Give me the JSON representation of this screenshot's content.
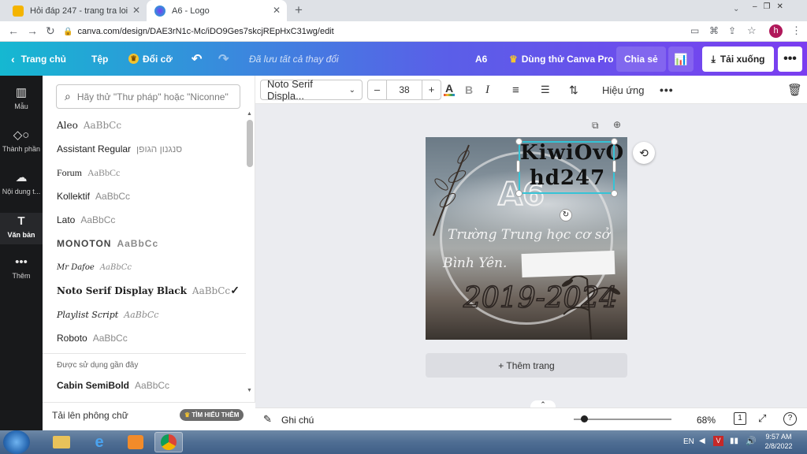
{
  "browser": {
    "tabs": [
      {
        "title": "Hỏi đáp 247 - trang tra loi",
        "active": false
      },
      {
        "title": "A6 - Logo",
        "active": true
      }
    ],
    "new_tab": "+",
    "url": "canva.com/design/DAE3rN1c-Mc/iDO9Ges7skcjREpHxC31wg/edit",
    "profile_initial": "h"
  },
  "header": {
    "home": "Trang chủ",
    "file": "Tệp",
    "resize": "Đổi cỡ",
    "saved": "Đã lưu tất cả thay đổi",
    "design_name": "A6",
    "try_pro": "Dùng thử Canva Pro",
    "share": "Chia sẻ",
    "download": "Tải xuống"
  },
  "rail": [
    {
      "label": "Mẫu",
      "icon": "template-icon"
    },
    {
      "label": "Thành phần",
      "icon": "elements-icon"
    },
    {
      "label": "Nội dung t...",
      "icon": "upload-icon"
    },
    {
      "label": "Văn bản",
      "icon": "text-icon",
      "active": true
    },
    {
      "label": "Thêm",
      "icon": "more-icon"
    }
  ],
  "font_panel": {
    "search_placeholder": "Hãy thử \"Thư pháp\" hoặc \"Niconne\"",
    "fonts": [
      {
        "name": "Aleo",
        "sample": "AaBbCc"
      },
      {
        "name": "Assistant Regular",
        "sample": "סנגנון הגופן"
      },
      {
        "name": "Forum",
        "sample": "AaBbCc"
      },
      {
        "name": "Kollektif",
        "sample": "AaBbCc"
      },
      {
        "name": "Lato",
        "sample": "AaBbCc"
      },
      {
        "name": "MONOTON",
        "sample": "AaBbCc"
      },
      {
        "name": "Mr Dafoe",
        "sample": "AaBbCc"
      },
      {
        "name": "Noto Serif Display Black",
        "sample": "AaBbCc",
        "selected": true
      },
      {
        "name": "Playlist Script",
        "sample": "AaBbCc"
      },
      {
        "name": "Roboto",
        "sample": "AaBbCc"
      }
    ],
    "recent_heading": "Được sử dụng gần đây",
    "recent": [
      {
        "name": "Cabin SemiBold",
        "sample": "AaBbCc"
      }
    ],
    "upload_font": "Tải lên phông chữ",
    "learn_more": "TÌM HIỂU THÊM"
  },
  "toolbar": {
    "font_family": "Noto Serif Displa...",
    "font_size": "38",
    "minus": "–",
    "plus": "+",
    "effects": "Hiệu ứng",
    "text_color": "#e53935"
  },
  "design": {
    "selected_text_line1": "KiwiOvO",
    "selected_text_line2": "hd247",
    "big_label": "A6",
    "school_line1": "Trường Trung học cơ sở",
    "school_line2": "Bình Yên.",
    "years": "2019-2024"
  },
  "canvas": {
    "add_page": "+ Thêm trang"
  },
  "bottom": {
    "notes": "Ghi chú",
    "zoom": "68%",
    "page_count": "1",
    "help": "?"
  },
  "taskbar": {
    "lang": "EN",
    "time": "9:57 AM",
    "date": "2/8/2022"
  }
}
